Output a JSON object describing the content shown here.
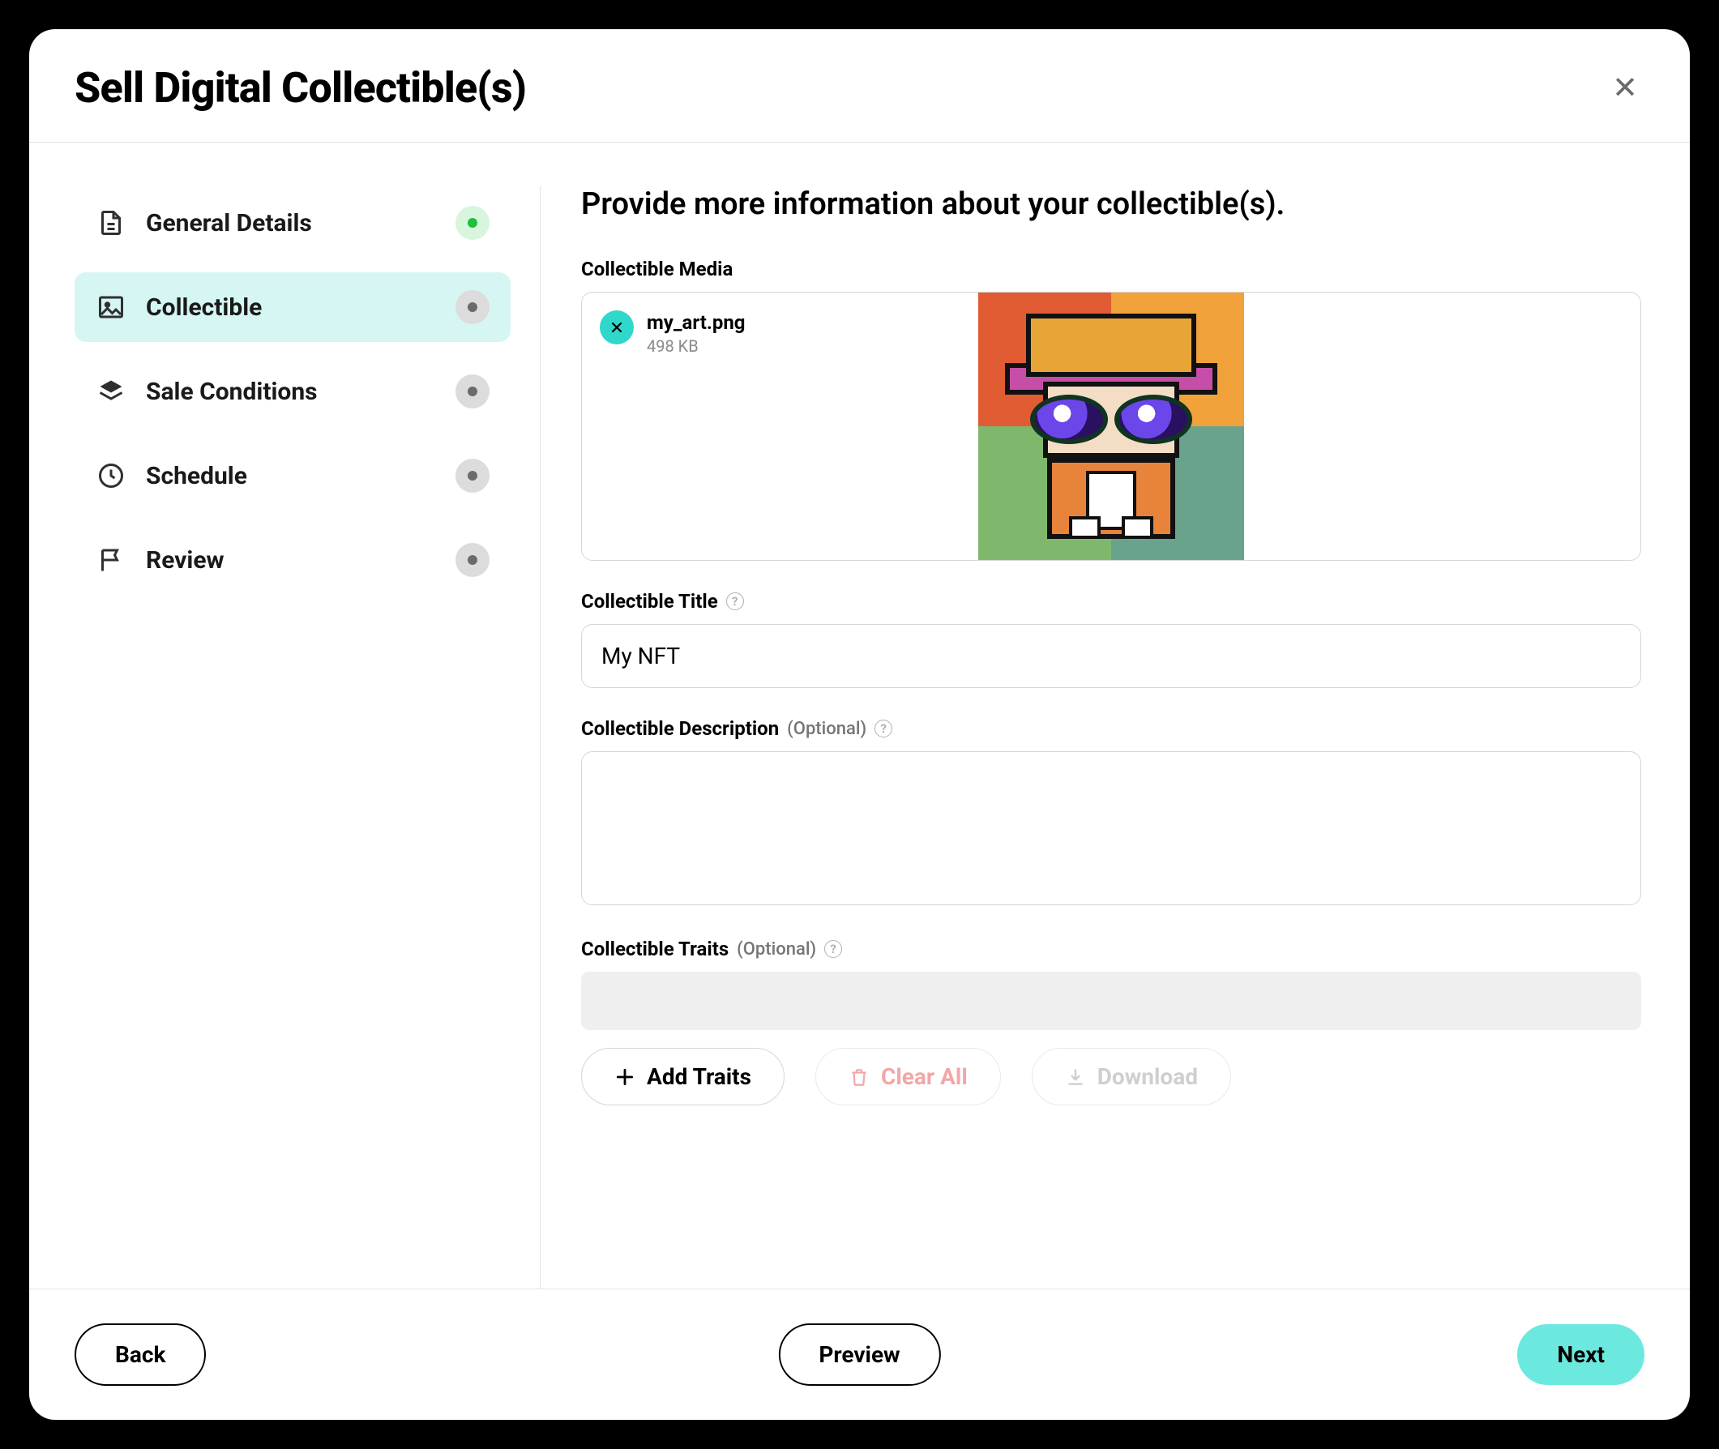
{
  "header": {
    "title": "Sell Digital Collectible(s)"
  },
  "sidebar": {
    "steps": [
      {
        "label": "General Details",
        "status": "done"
      },
      {
        "label": "Collectible",
        "status": "active"
      },
      {
        "label": "Sale Conditions",
        "status": "todo"
      },
      {
        "label": "Schedule",
        "status": "todo"
      },
      {
        "label": "Review",
        "status": "todo"
      }
    ]
  },
  "content": {
    "heading": "Provide more information about your collectible(s).",
    "media": {
      "label": "Collectible Media",
      "file_name": "my_art.png",
      "file_size": "498 KB"
    },
    "title_field": {
      "label": "Collectible Title",
      "value": "My NFT"
    },
    "description_field": {
      "label": "Collectible Description",
      "optional": "(Optional)",
      "value": ""
    },
    "traits": {
      "label": "Collectible Traits",
      "optional": "(Optional)",
      "add_label": "Add Traits",
      "clear_label": "Clear All",
      "download_label": "Download"
    }
  },
  "footer": {
    "back": "Back",
    "preview": "Preview",
    "next": "Next"
  }
}
